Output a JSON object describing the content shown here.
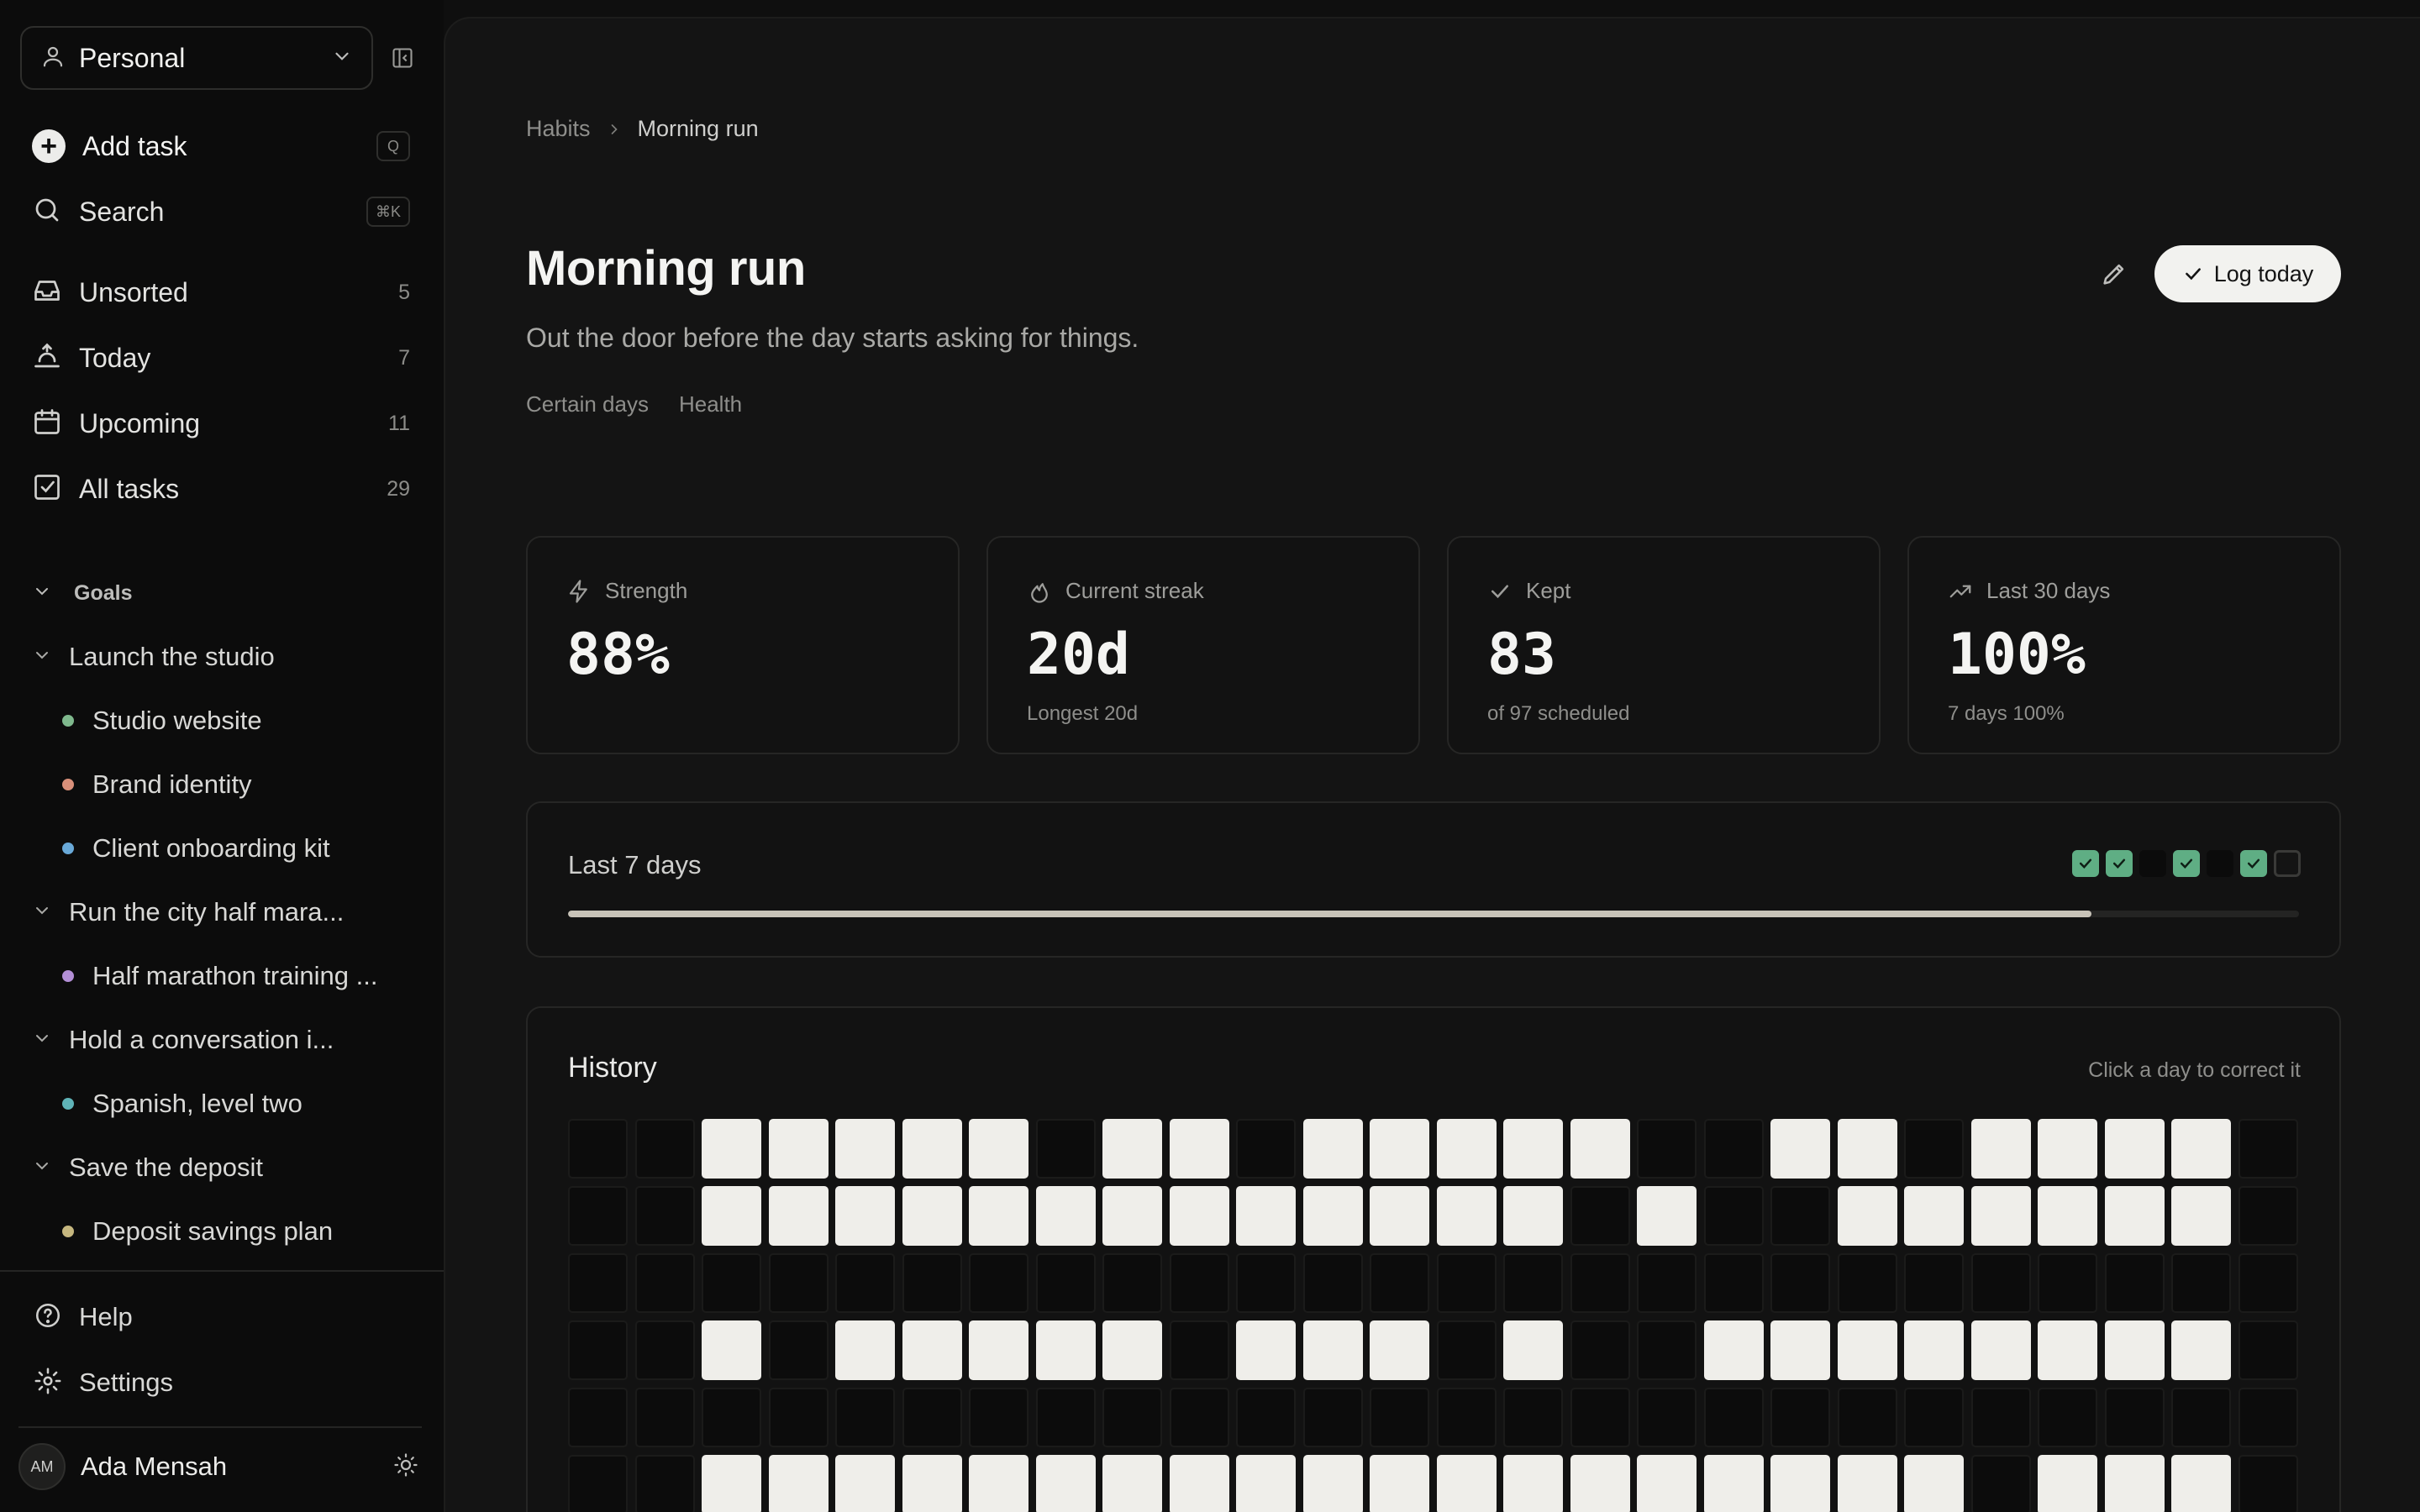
{
  "sidebar": {
    "workspace": "Personal",
    "add_task": {
      "label": "Add task",
      "shortcut": "Q"
    },
    "search": {
      "label": "Search",
      "shortcut": "⌘K"
    },
    "nav": [
      {
        "label": "Unsorted",
        "count": "5",
        "icon": "inbox-icon"
      },
      {
        "label": "Today",
        "count": "7",
        "icon": "sunrise-icon"
      },
      {
        "label": "Upcoming",
        "count": "11",
        "icon": "calendar-icon"
      },
      {
        "label": "All tasks",
        "count": "29",
        "icon": "checkbox-icon"
      }
    ],
    "goals_heading": "Goals",
    "goals": [
      {
        "label": "Launch the studio",
        "items": [
          {
            "label": "Studio website",
            "color": "#7fb98d"
          },
          {
            "label": "Brand identity",
            "color": "#d9907a"
          },
          {
            "label": "Client onboarding kit",
            "color": "#69a9d8"
          }
        ]
      },
      {
        "label": "Run the city half mara...",
        "items": [
          {
            "label": "Half marathon training ...",
            "color": "#b38fd6"
          }
        ]
      },
      {
        "label": "Hold a conversation i...",
        "items": [
          {
            "label": "Spanish, level two",
            "color": "#5fb4b8"
          }
        ]
      },
      {
        "label": "Save the deposit",
        "items": [
          {
            "label": "Deposit savings plan",
            "color": "#c6b77f"
          }
        ]
      }
    ],
    "help": "Help",
    "settings": "Settings",
    "user": {
      "initials": "AM",
      "name": "Ada Mensah"
    }
  },
  "breadcrumb": {
    "parent": "Habits",
    "current": "Morning run"
  },
  "habit": {
    "title": "Morning run",
    "description": "Out the door before the day starts asking for things.",
    "tags": [
      "Certain days",
      "Health"
    ],
    "log_button": "Log today"
  },
  "stats": [
    {
      "label": "Strength",
      "value": "88%",
      "sub": "",
      "icon": "bolt-icon"
    },
    {
      "label": "Current streak",
      "value": "20d",
      "sub": "Longest 20d",
      "icon": "flame-icon"
    },
    {
      "label": "Kept",
      "value": "83",
      "sub": "of 97 scheduled",
      "icon": "check-icon"
    },
    {
      "label": "Last 30 days",
      "value": "100%",
      "sub": "7 days 100%",
      "icon": "trend-up-icon"
    }
  ],
  "last7": {
    "title": "Last 7 days",
    "days": [
      "done",
      "done",
      "miss",
      "done",
      "miss",
      "done",
      "today"
    ],
    "progress": 0.88
  },
  "history": {
    "title": "History",
    "hint": "Click a day to correct it",
    "rows": [
      "0011111011011111001101111",
      "0011111111111110100111111",
      "0000000000000000000000000",
      "0010111110111010011111111",
      "0000000000000000000000000",
      "0011111111111111111110111"
    ]
  }
}
